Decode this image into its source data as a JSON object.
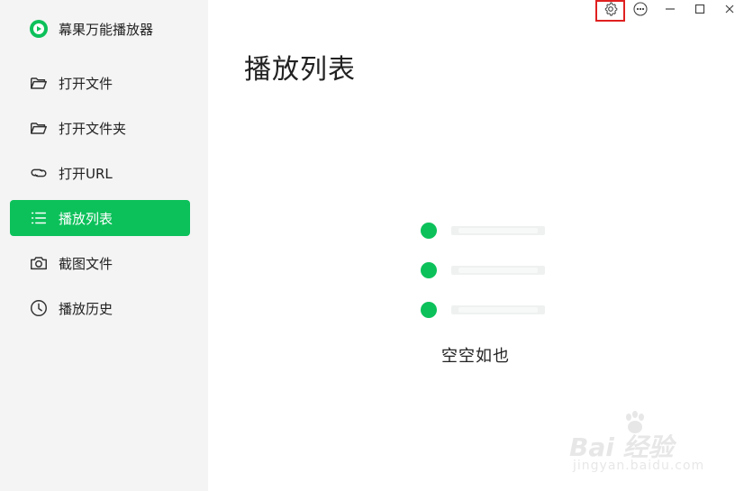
{
  "app": {
    "name": "幕果万能播放器"
  },
  "colors": {
    "accent": "#0cc15a",
    "sidebar_bg": "#f4f4f4",
    "highlight_box": "#e02020"
  },
  "sidebar": {
    "items": [
      {
        "label": "打开文件",
        "icon": "folder-open-icon",
        "active": false
      },
      {
        "label": "打开文件夹",
        "icon": "folder-open-icon",
        "active": false
      },
      {
        "label": "打开URL",
        "icon": "link-icon",
        "active": false
      },
      {
        "label": "播放列表",
        "icon": "list-icon",
        "active": true
      },
      {
        "label": "截图文件",
        "icon": "camera-icon",
        "active": false
      },
      {
        "label": "播放历史",
        "icon": "clock-icon",
        "active": false
      }
    ]
  },
  "titlebar": {
    "buttons": [
      "settings-icon",
      "more-icon",
      "minimize-icon",
      "maximize-icon",
      "close-icon"
    ],
    "highlighted": "settings-icon"
  },
  "main": {
    "title": "播放列表",
    "empty_text": "空空如也"
  },
  "watermark": {
    "main": "Bai 经验",
    "sub": "jingyan.baidu.com"
  }
}
